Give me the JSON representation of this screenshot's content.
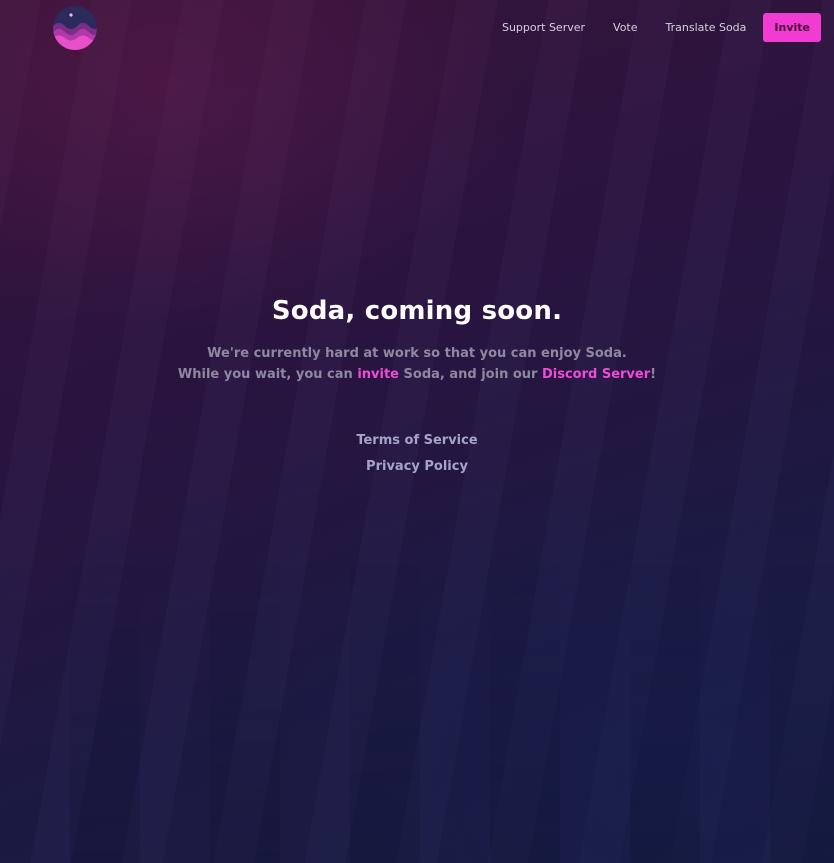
{
  "nav": {
    "links": [
      "Support Server",
      "Vote",
      "Translate Soda"
    ],
    "invite_button": "Invite"
  },
  "hero": {
    "title": "Soda, coming soon.",
    "line1": "We're currently hard at work so that you can enjoy Soda.",
    "line2_prefix": "While you wait, you can ",
    "invite_link": "invite",
    "line2_middle": " Soda, and join our ",
    "discord_link": "Discord Server",
    "line2_suffix": "!"
  },
  "footer": {
    "terms": "Terms of Service",
    "privacy": "Privacy Policy"
  },
  "colors": {
    "accent": "#f23bd3",
    "background": "#2a1542",
    "text_muted": "#8e88a0"
  },
  "icons": {
    "logo": "soda-logo-icon"
  }
}
